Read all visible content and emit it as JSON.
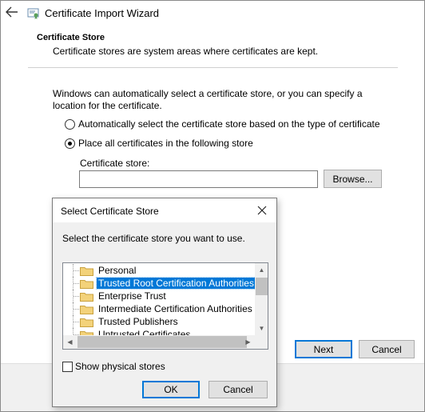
{
  "wizard": {
    "title": "Certificate Import Wizard",
    "header_title": "Certificate Store",
    "header_description": "Certificate stores are system areas where certificates are kept.",
    "intro": "Windows can automatically select a certificate store, or you can specify a location for the certificate.",
    "radio_auto_label": "Automatically select the certificate store based on the type of certificate",
    "radio_place_label": "Place all certificates in the following store",
    "selected_option": "place",
    "store_label": "Certificate store:",
    "store_value": "",
    "browse_label": "Browse...",
    "next_label": "Next",
    "cancel_label": "Cancel"
  },
  "dialog": {
    "title": "Select Certificate Store",
    "prompt": "Select the certificate store you want to use.",
    "stores": [
      {
        "label": "Personal",
        "selected": false
      },
      {
        "label": "Trusted Root Certification Authorities",
        "selected": true
      },
      {
        "label": "Enterprise Trust",
        "selected": false
      },
      {
        "label": "Intermediate Certification Authorities",
        "selected": false
      },
      {
        "label": "Trusted Publishers",
        "selected": false
      },
      {
        "label": "Untrusted Certificates",
        "selected": false
      }
    ],
    "show_physical_label": "Show physical stores",
    "show_physical_checked": false,
    "ok_label": "OK",
    "cancel_label": "Cancel"
  },
  "colors": {
    "selection": "#0078d7",
    "default_button_border": "#0078d7",
    "folder": "#e8c05a"
  },
  "icons": [
    "back-arrow-icon",
    "certificate-icon",
    "close-icon",
    "folder-icon",
    "chevron-up-icon",
    "chevron-down-icon",
    "chevron-left-icon",
    "chevron-right-icon"
  ]
}
